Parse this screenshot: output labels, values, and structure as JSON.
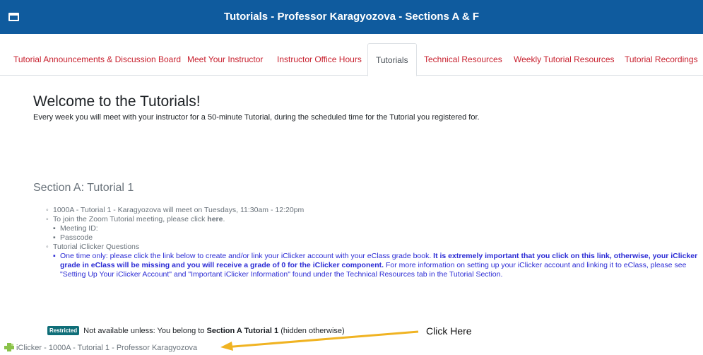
{
  "header": {
    "title": "Tutorials - Professor Karagyozova - Sections A & F"
  },
  "tabs": [
    {
      "label": "Tutorial Announcements & Discussion Board"
    },
    {
      "label": "Meet Your Instructor"
    },
    {
      "label": "Instructor Office Hours"
    },
    {
      "label": "Tutorials",
      "active": true
    },
    {
      "label": "Technical Resources"
    },
    {
      "label": "Weekly Tutorial Resources"
    },
    {
      "label": "Tutorial Recordings"
    }
  ],
  "welcome": {
    "heading": "Welcome to the Tutorials!",
    "intro": "Every week you will meet with your instructor for a 50-minute Tutorial, during the scheduled time for the Tutorial you registered for."
  },
  "section": {
    "title": "Section A:  Tutorial 1",
    "item1": "1000A - Tutorial 1 - Karagyozova will meet on Tuesdays, 11:30am - 12:20pm",
    "zoom_prefix": "To join the Zoom Tutorial meeting, please click ",
    "zoom_link": "here",
    "zoom_suffix": ".",
    "meeting_id": "Meeting ID:",
    "passcode": "Passcode",
    "iclicker_heading": "Tutorial iClicker Questions",
    "note_part1": "One time only:  please click the link below to create and/or link your iClicker account with your eClass grade book.  ",
    "note_bold": "It is extremely important that you click on this link, otherwise, your iClicker grade in eClass will be missing and you will receive a grade of 0 for the iClicker component.",
    "note_part2": "  For more information on setting up your iClicker account and linking it to eClass, please see \"Setting Up Your iClicker Account\" and \"Important iClicker Information\" found under the Technical Resources tab in the Tutorial Section."
  },
  "restriction": {
    "badge": "Restricted",
    "text_prefix": " Not available unless: You belong to ",
    "group": "Section A Tutorial 1",
    "text_suffix": " (hidden otherwise)"
  },
  "activity": {
    "icon": "puzzle-icon",
    "label": "iClicker - 1000A - Tutorial 1 - Professor Karagyozova"
  },
  "annotation": {
    "label": "Click Here",
    "arrow_color": "#f0b322"
  },
  "colors": {
    "header_bg": "#0f5b9e",
    "tab_link": "#c8202e",
    "note_blue": "#2b2bd4",
    "badge_bg": "#0f6e78"
  }
}
